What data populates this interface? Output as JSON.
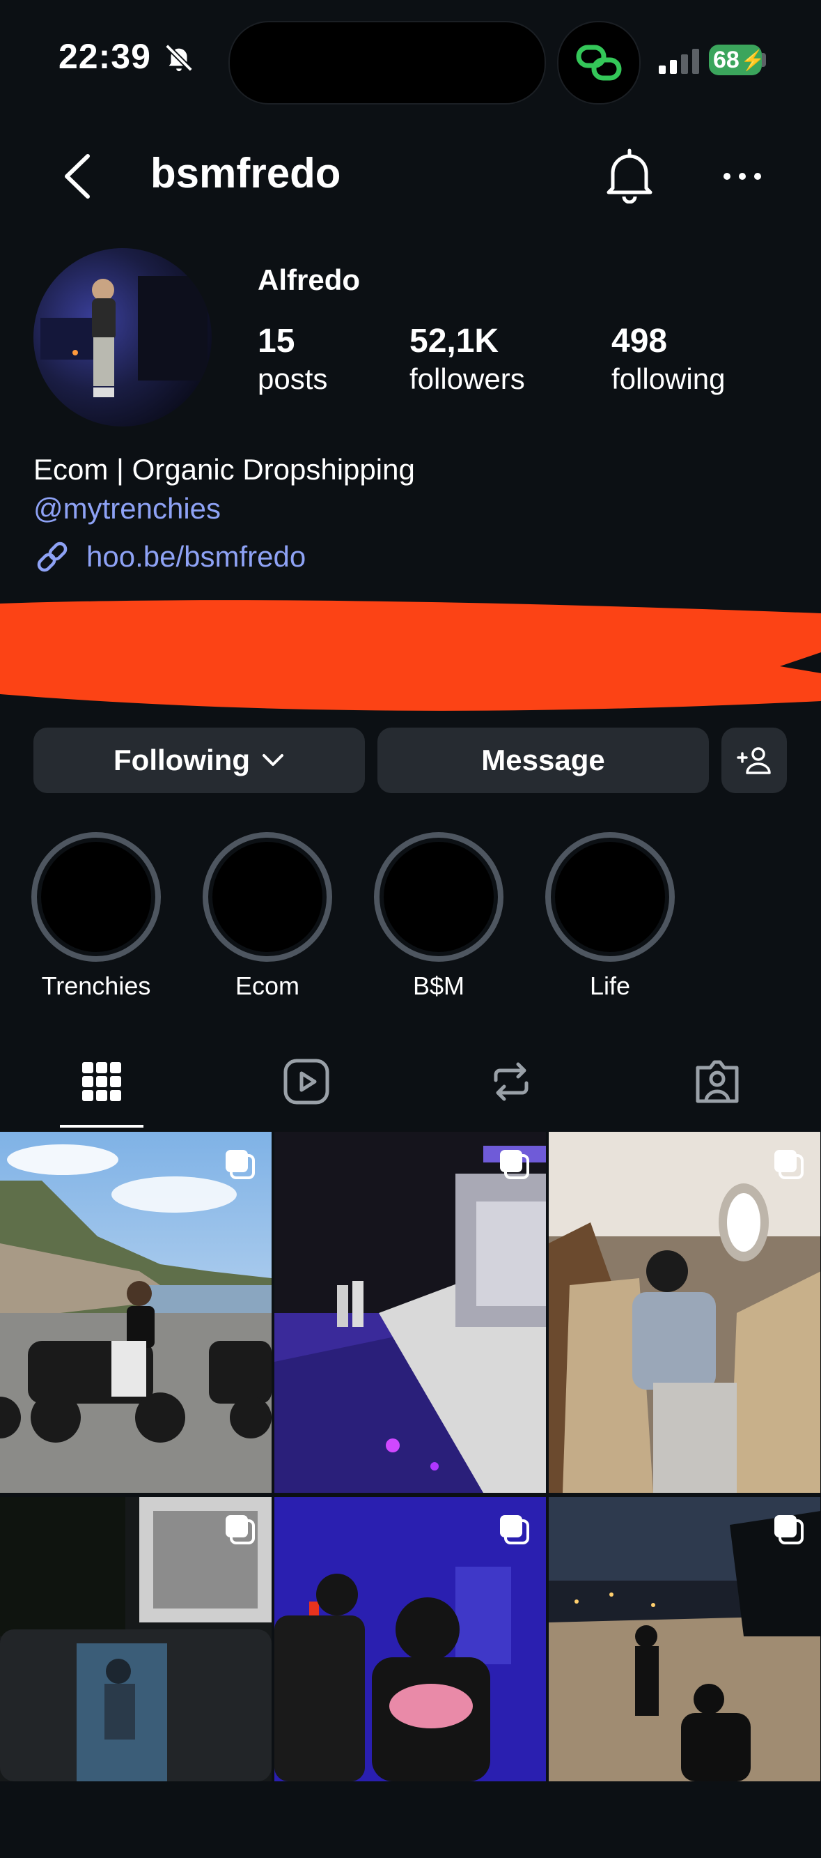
{
  "status_bar": {
    "time": "22:39",
    "battery": "68"
  },
  "header": {
    "username": "bsmfredo"
  },
  "profile": {
    "display_name": "Alfredo",
    "stats": [
      {
        "value": "15",
        "label": "posts"
      },
      {
        "value": "52,1K",
        "label": "followers"
      },
      {
        "value": "498",
        "label": "following"
      }
    ],
    "bio": "Ecom | Organic Dropshipping",
    "mention": "@mytrenchies",
    "link": "hoo.be/bsmfredo"
  },
  "actions": {
    "following_label": "Following",
    "message_label": "Message"
  },
  "highlights": [
    {
      "label": "Trenchies"
    },
    {
      "label": "Ecom"
    },
    {
      "label": "B$M"
    },
    {
      "label": "Life"
    }
  ],
  "tabs": [
    "grid-icon",
    "reels-icon",
    "reposts-icon",
    "tagged-icon"
  ],
  "colors": {
    "background": "#0c1014",
    "link": "#8ea2f5",
    "button": "#262b31",
    "redaction": "#fc4315"
  }
}
